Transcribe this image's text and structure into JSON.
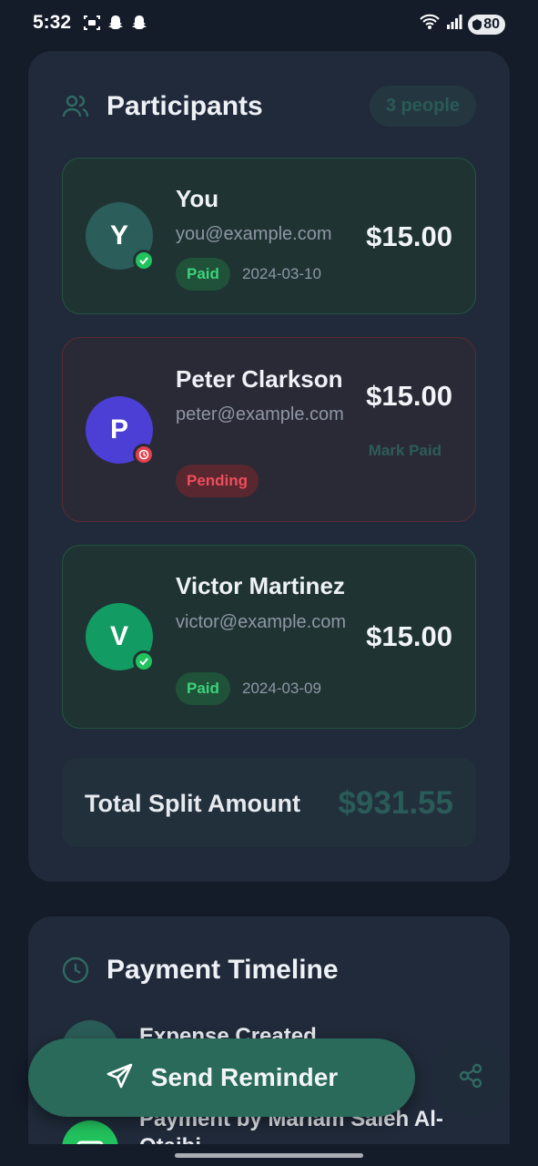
{
  "status_bar": {
    "time": "5:32",
    "battery": "80",
    "icons_left": [
      "screenshot-icon",
      "snapchat-icon",
      "snapchat-icon"
    ],
    "icons_right": [
      "wifi-icon",
      "signal-icon",
      "battery-icon"
    ]
  },
  "participants": {
    "title": "Participants",
    "count_badge": "3 people",
    "items": [
      {
        "initial": "Y",
        "name": "You",
        "email": "you@example.com",
        "amount": "$15.00",
        "status": "Paid",
        "date": "2024-03-10",
        "avatar_color": "#2b5e5a"
      },
      {
        "initial": "P",
        "name": "Peter Clarkson",
        "email": "peter@example.com",
        "amount": "$15.00",
        "status": "Pending",
        "action": "Mark Paid",
        "avatar_color": "#4b3fd6"
      },
      {
        "initial": "V",
        "name": "Victor Martinez",
        "email": "victor@example.com",
        "amount": "$15.00",
        "status": "Paid",
        "date": "2024-03-09",
        "avatar_color": "#129b63"
      }
    ],
    "total_label": "Total Split Amount",
    "total_value": "$931.55"
  },
  "timeline": {
    "title": "Payment Timeline",
    "events": [
      {
        "title": "Expense Created"
      },
      {
        "title": "Payment by Mariam Saleh Al-Otaibi"
      }
    ]
  },
  "actions": {
    "send_reminder": "Send Reminder"
  },
  "colors": {
    "accent": "#2a6a5a",
    "paid": "#3bd27b",
    "pending": "#ef4d5b",
    "background": "#141b29",
    "card": "#202a3a"
  }
}
